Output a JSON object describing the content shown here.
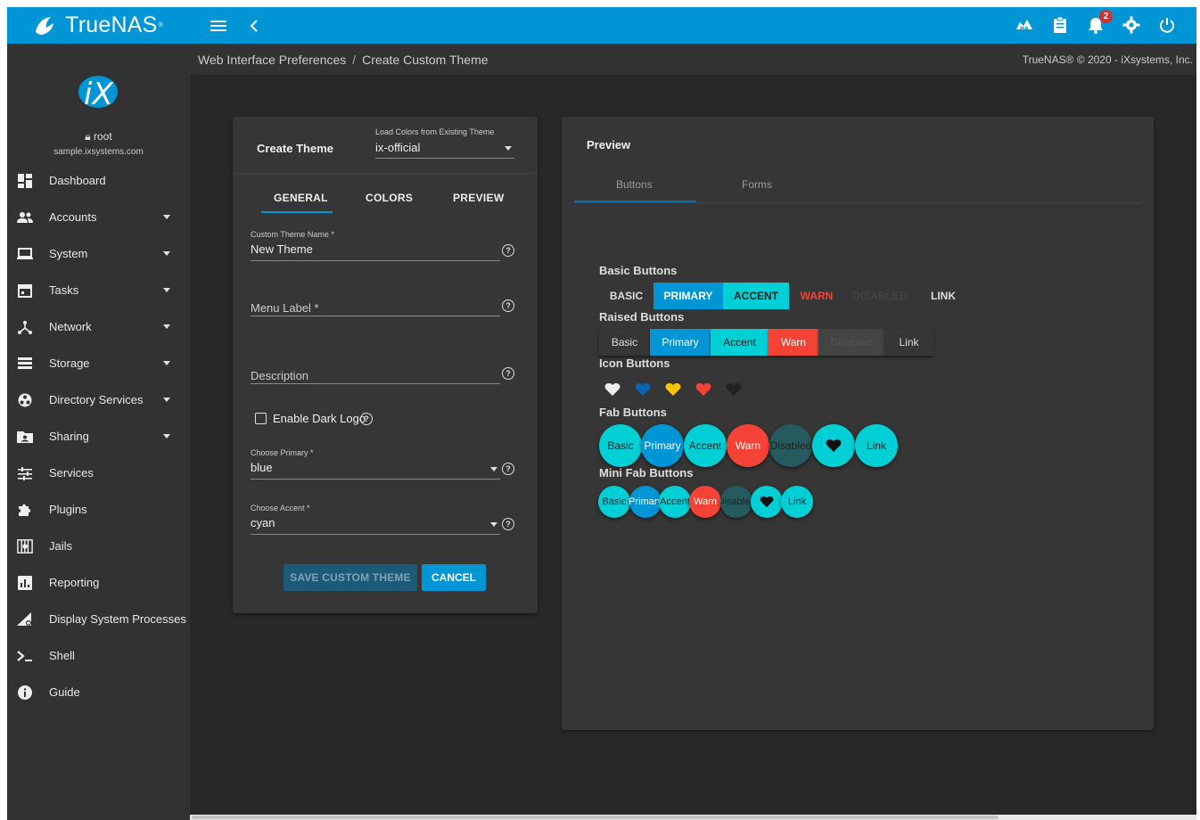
{
  "brand": {
    "name": "TrueNAS",
    "tm": "®"
  },
  "colors": {
    "primary": "#0095d5",
    "accent": "#00d0d6",
    "warn": "#f44336",
    "yellow": "#f6c500",
    "blue": "#0a64b4",
    "disabled": "#255a5f"
  },
  "topbar": {
    "left_icons": [
      "menu-icon",
      "chevron-left-icon"
    ],
    "right_icons": [
      "ha-icon",
      "clipboard-icon",
      "bell-icon",
      "gear-icon",
      "power-icon"
    ],
    "notifications_count": "2"
  },
  "user": {
    "name": "root",
    "host": "sample.ixsystems.com"
  },
  "sidebar": {
    "items": [
      {
        "label": "Dashboard",
        "icon": "dashboard-icon",
        "caret": false
      },
      {
        "label": "Accounts",
        "icon": "accounts-icon",
        "caret": true
      },
      {
        "label": "System",
        "icon": "laptop-icon",
        "caret": true
      },
      {
        "label": "Tasks",
        "icon": "calendar-icon",
        "caret": true
      },
      {
        "label": "Network",
        "icon": "network-icon",
        "caret": true
      },
      {
        "label": "Storage",
        "icon": "storage-icon",
        "caret": true
      },
      {
        "label": "Directory Services",
        "icon": "directory-icon",
        "caret": true
      },
      {
        "label": "Sharing",
        "icon": "sharing-icon",
        "caret": true
      },
      {
        "label": "Services",
        "icon": "services-icon",
        "caret": false
      },
      {
        "label": "Plugins",
        "icon": "puzzle-icon",
        "caret": false
      },
      {
        "label": "Jails",
        "icon": "jail-icon",
        "caret": false
      },
      {
        "label": "Reporting",
        "icon": "reporting-icon",
        "caret": false
      },
      {
        "label": "Display System Processes",
        "icon": "processes-icon",
        "caret": false
      },
      {
        "label": "Shell",
        "icon": "shell-icon",
        "caret": false
      },
      {
        "label": "Guide",
        "icon": "info-icon",
        "caret": false
      }
    ]
  },
  "breadcrumb": {
    "parent": "Web Interface Preferences",
    "sep": "/",
    "current": "Create Custom Theme"
  },
  "copyright": "TrueNAS® © 2020 - iXsystems, Inc.",
  "form": {
    "title": "Create Theme",
    "load_label": "Load Colors from Existing Theme",
    "load_value": "ix-official",
    "tabs": [
      "GENERAL",
      "COLORS",
      "PREVIEW"
    ],
    "name_label": "Custom Theme Name *",
    "name_value": "New Theme",
    "menu_label_placeholder": "Menu Label *",
    "description_placeholder": "Description",
    "dark_logo_label": "Enable Dark Logo",
    "primary_label": "Choose Primary *",
    "primary_value": "blue",
    "accent_label": "Choose Accent *",
    "accent_value": "cyan",
    "save_label": "SAVE CUSTOM THEME",
    "cancel_label": "CANCEL"
  },
  "preview": {
    "title": "Preview",
    "tabs": [
      "Buttons",
      "Forms"
    ],
    "basic_title": "Basic Buttons",
    "basic": [
      "BASIC",
      "PRIMARY",
      "ACCENT",
      "WARN",
      "DISABLED",
      "LINK"
    ],
    "raised_title": "Raised Buttons",
    "raised": [
      "Basic",
      "Primary",
      "Accent",
      "Warn",
      "Disabled",
      "Link"
    ],
    "icon_title": "Icon Buttons",
    "fab_title": "Fab Buttons",
    "fab": [
      "Basic",
      "Primary",
      "Accent",
      "Warn",
      "Disabled",
      "Link"
    ],
    "mini_title": "Mini Fab Buttons",
    "mini": [
      "Basic",
      "Primary",
      "Accent",
      "Warn",
      "Disabled",
      "Link"
    ]
  }
}
